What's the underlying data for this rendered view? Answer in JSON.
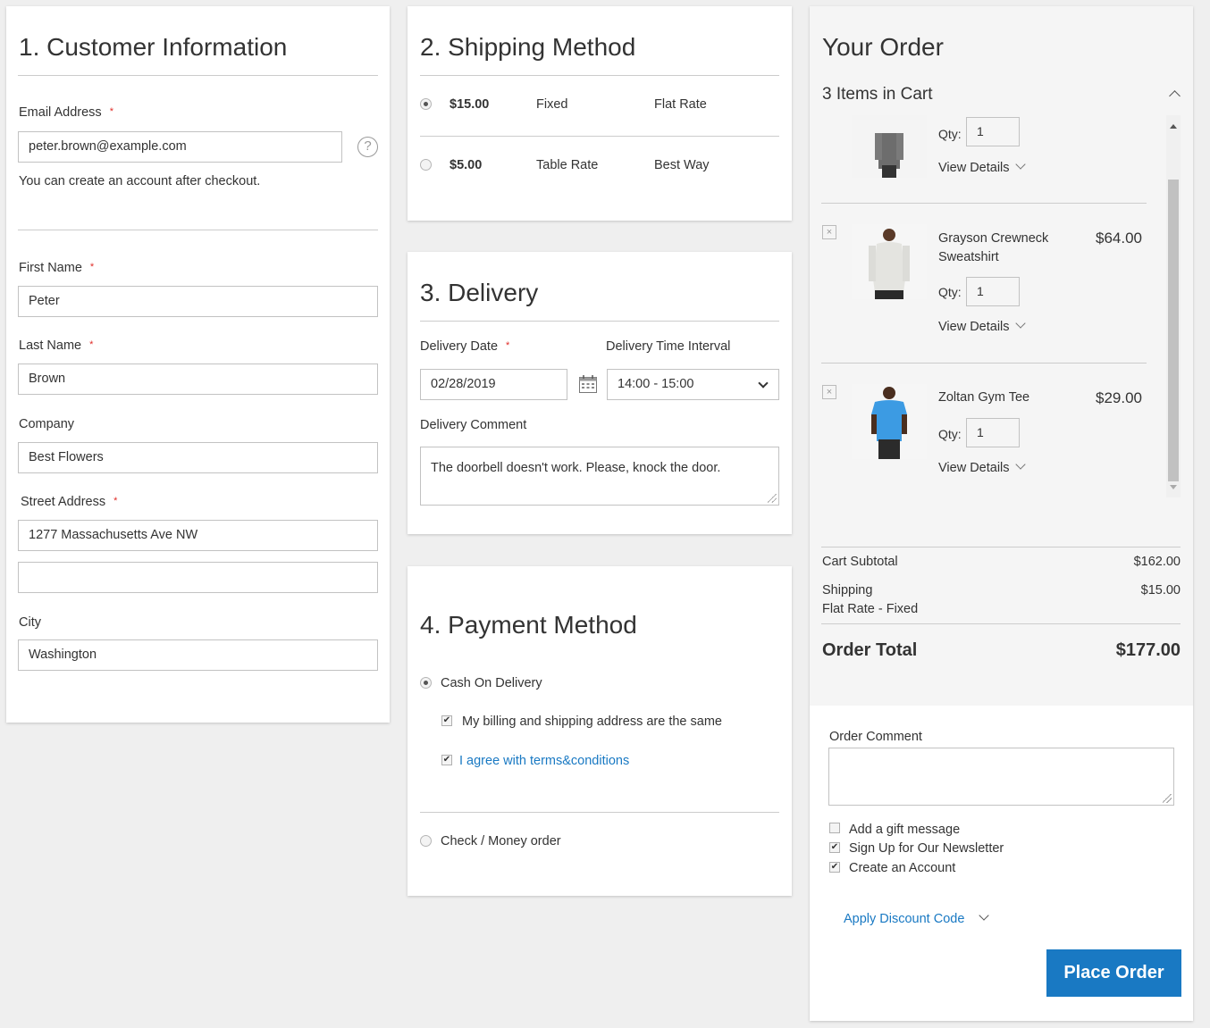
{
  "customer": {
    "title": "1. Customer Information",
    "email_label": "Email Address",
    "email_value": "peter.brown@example.com",
    "email_note": "You can create an account after checkout.",
    "first_name_label": "First Name",
    "first_name_value": "Peter",
    "last_name_label": "Last Name",
    "last_name_value": "Brown",
    "company_label": "Company",
    "company_value": "Best Flowers",
    "street_label": "Street Address",
    "street_value_1": "1277 Massachusetts Ave NW",
    "street_value_2": "",
    "city_label": "City",
    "city_value": "Washington",
    "required_mark": "*",
    "help_glyph": "?"
  },
  "shipping": {
    "title": "2. Shipping Method",
    "options": [
      {
        "price": "$15.00",
        "method": "Fixed",
        "carrier": "Flat Rate",
        "selected": true
      },
      {
        "price": "$5.00",
        "method": "Table Rate",
        "carrier": "Best Way",
        "selected": false
      }
    ]
  },
  "delivery": {
    "title": "3. Delivery",
    "date_label": "Delivery Date",
    "date_value": "02/28/2019",
    "interval_label": "Delivery Time Interval",
    "interval_value": "14:00 - 15:00",
    "comment_label": "Delivery Comment",
    "comment_value": "The doorbell doesn't work. Please, knock the door."
  },
  "payment": {
    "title": "4. Payment Method",
    "options": [
      {
        "label": "Cash On Delivery",
        "selected": true
      },
      {
        "label": "Check / Money order",
        "selected": false
      }
    ],
    "billing_same_label": "My billing and shipping address are the same",
    "billing_same_checked": true,
    "terms_label": "I agree with terms&conditions",
    "terms_checked": true
  },
  "order": {
    "title": "Your Order",
    "items_in_cart": "3 Items in Cart",
    "qty_label": "Qty:",
    "view_details": "View Details",
    "remove_glyph": "×",
    "items": [
      {
        "name": "",
        "price": "",
        "qty": "1"
      },
      {
        "name": "Grayson Crewneck Sweatshirt",
        "name_line1": "Grayson Crewneck",
        "name_line2": "Sweatshirt",
        "price": "$64.00",
        "qty": "1"
      },
      {
        "name": "Zoltan Gym Tee",
        "price": "$29.00",
        "qty": "1"
      }
    ],
    "subtotal_label": "Cart Subtotal",
    "subtotal_value": "$162.00",
    "shipping_label": "Shipping",
    "shipping_sub": "Flat Rate - Fixed",
    "shipping_value": "$15.00",
    "total_label": "Order Total",
    "total_value": "$177.00",
    "comment_label": "Order Comment",
    "gift_label": "Add a gift message",
    "gift_checked": false,
    "newsletter_label": "Sign Up for Our Newsletter",
    "newsletter_checked": true,
    "create_account_label": "Create an Account",
    "create_account_checked": true,
    "discount_label": "Apply Discount Code",
    "place_order_label": "Place Order",
    "check_glyph": "✔"
  },
  "colors": {
    "accent": "#1979c3",
    "required": "#e02b27",
    "background": "#efefef",
    "summary_bg": "#f5f5f5"
  }
}
